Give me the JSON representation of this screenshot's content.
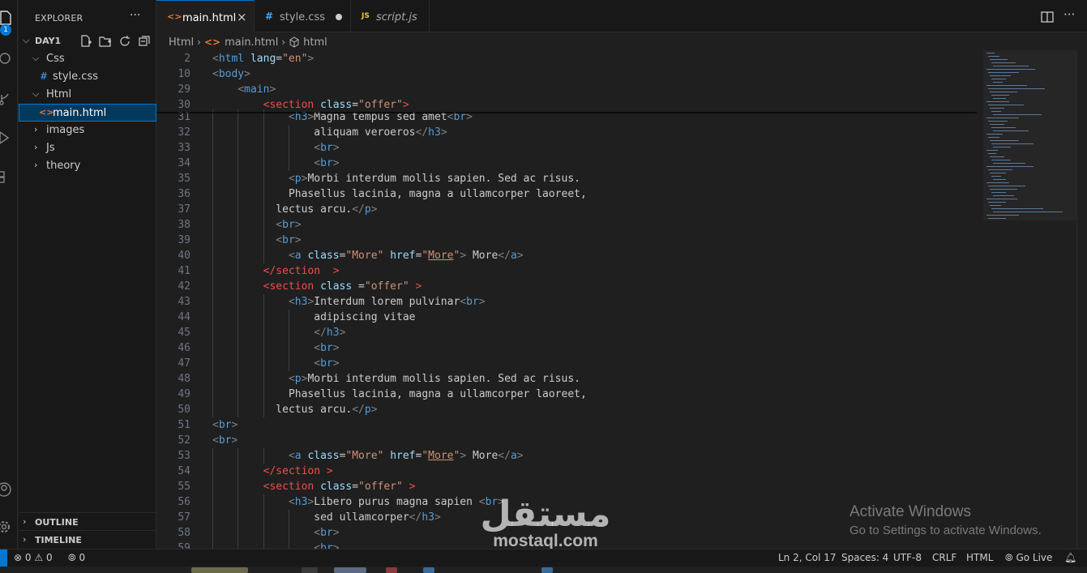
{
  "explorer": {
    "title": "EXPLORER",
    "more": "···",
    "folder": "DAY1",
    "items": [
      {
        "label": "Css",
        "type": "folder-open"
      },
      {
        "label": "style.css",
        "type": "css-file"
      },
      {
        "label": "Html",
        "type": "folder-open"
      },
      {
        "label": "main.html",
        "type": "html-file",
        "selected": true
      },
      {
        "label": "images",
        "type": "folder-closed"
      },
      {
        "label": "Js",
        "type": "folder-closed"
      },
      {
        "label": "theory",
        "type": "folder-closed"
      }
    ],
    "outline": "OUTLINE",
    "timeline": "TIMELINE"
  },
  "activity": {
    "badge": "1"
  },
  "tabs": [
    {
      "label": "main.html",
      "icon": "<>",
      "active": true,
      "close": "×"
    },
    {
      "label": "style.css",
      "icon": "#",
      "modified": true
    },
    {
      "label": "script.js",
      "icon": "JS"
    }
  ],
  "breadcrumb": [
    "Html",
    "main.html",
    "html"
  ],
  "lines": [
    {
      "n": "2",
      "indent": 0,
      "segs": [
        [
          "p",
          "<"
        ],
        [
          "t",
          "html"
        ],
        [
          "x",
          " "
        ],
        [
          "a",
          "lang"
        ],
        [
          "x",
          "="
        ],
        [
          "s",
          "\"en\""
        ],
        [
          "p",
          ">"
        ]
      ]
    },
    {
      "n": "10",
      "indent": 0,
      "segs": [
        [
          "p",
          "<"
        ],
        [
          "t",
          "body"
        ],
        [
          "p",
          ">"
        ]
      ]
    },
    {
      "n": "29",
      "indent": 4,
      "segs": [
        [
          "p",
          "<"
        ],
        [
          "t",
          "main"
        ],
        [
          "p",
          ">"
        ]
      ]
    },
    {
      "n": "30",
      "indent": 8,
      "segs": [
        [
          "p",
          "<"
        ],
        [
          "t",
          "section"
        ],
        [
          "x",
          " "
        ],
        [
          "a",
          "class"
        ],
        [
          "x",
          "="
        ],
        [
          "s",
          "\"offer\""
        ],
        [
          "p",
          ">"
        ]
      ]
    },
    {
      "n": "31",
      "indent": 12,
      "segs": [
        [
          "p",
          "<"
        ],
        [
          "t",
          "h3"
        ],
        [
          "p",
          ">"
        ],
        [
          "x",
          "Magna tempus sed amet"
        ],
        [
          "p",
          "<"
        ],
        [
          "t",
          "br"
        ],
        [
          "p",
          ">"
        ]
      ]
    },
    {
      "n": "32",
      "indent": 16,
      "segs": [
        [
          "x",
          "aliquam veroeros"
        ],
        [
          "p",
          "</"
        ],
        [
          "t",
          "h3"
        ],
        [
          "p",
          ">"
        ]
      ]
    },
    {
      "n": "33",
      "indent": 16,
      "segs": [
        [
          "p",
          "<"
        ],
        [
          "t",
          "br"
        ],
        [
          "p",
          ">"
        ]
      ]
    },
    {
      "n": "34",
      "indent": 16,
      "segs": [
        [
          "p",
          "<"
        ],
        [
          "t",
          "br"
        ],
        [
          "p",
          ">"
        ]
      ]
    },
    {
      "n": "35",
      "indent": 12,
      "segs": [
        [
          "p",
          "<"
        ],
        [
          "t",
          "p"
        ],
        [
          "p",
          ">"
        ],
        [
          "x",
          "Morbi interdum mollis sapien. Sed ac risus."
        ]
      ]
    },
    {
      "n": "36",
      "indent": 12,
      "segs": [
        [
          "x",
          "Phasellus lacinia, magna a ullamcorper laoreet,"
        ]
      ]
    },
    {
      "n": "37",
      "indent": 10,
      "segs": [
        [
          "x",
          "lectus arcu."
        ],
        [
          "p",
          "</"
        ],
        [
          "t",
          "p"
        ],
        [
          "p",
          ">"
        ]
      ]
    },
    {
      "n": "38",
      "indent": 10,
      "segs": [
        [
          "p",
          "<"
        ],
        [
          "t",
          "br"
        ],
        [
          "p",
          ">"
        ]
      ]
    },
    {
      "n": "39",
      "indent": 10,
      "segs": [
        [
          "p",
          "<"
        ],
        [
          "t",
          "br"
        ],
        [
          "p",
          ">"
        ]
      ]
    },
    {
      "n": "40",
      "indent": 12,
      "segs": [
        [
          "p",
          "<"
        ],
        [
          "t",
          "a"
        ],
        [
          "x",
          " "
        ],
        [
          "a",
          "class"
        ],
        [
          "x",
          "="
        ],
        [
          "s",
          "\"More\""
        ],
        [
          "x",
          " "
        ],
        [
          "a",
          "href"
        ],
        [
          "x",
          "="
        ],
        [
          "s",
          "\""
        ],
        [
          "su",
          "More"
        ],
        [
          "s",
          "\""
        ],
        [
          "p",
          ">"
        ],
        [
          "x",
          " More"
        ],
        [
          "p",
          "</"
        ],
        [
          "t",
          "a"
        ],
        [
          "p",
          ">"
        ]
      ]
    },
    {
      "n": "41",
      "indent": 8,
      "segs": [
        [
          "p",
          "</"
        ],
        [
          "t",
          "section"
        ],
        [
          "x",
          "  "
        ],
        [
          "p",
          ">"
        ]
      ]
    },
    {
      "n": "42",
      "indent": 8,
      "segs": [
        [
          "p",
          "<"
        ],
        [
          "t",
          "section"
        ],
        [
          "x",
          " "
        ],
        [
          "a",
          "class"
        ],
        [
          "x",
          " ="
        ],
        [
          "s",
          "\"offer\""
        ],
        [
          "x",
          " "
        ],
        [
          "p",
          ">"
        ]
      ]
    },
    {
      "n": "43",
      "indent": 12,
      "segs": [
        [
          "p",
          "<"
        ],
        [
          "t",
          "h3"
        ],
        [
          "p",
          ">"
        ],
        [
          "x",
          "Interdum lorem pulvinar"
        ],
        [
          "p",
          "<"
        ],
        [
          "t",
          "br"
        ],
        [
          "p",
          ">"
        ]
      ]
    },
    {
      "n": "44",
      "indent": 16,
      "segs": [
        [
          "x",
          "adipiscing vitae"
        ]
      ]
    },
    {
      "n": "45",
      "indent": 16,
      "segs": [
        [
          "p",
          "</"
        ],
        [
          "t",
          "h3"
        ],
        [
          "p",
          ">"
        ]
      ]
    },
    {
      "n": "46",
      "indent": 16,
      "segs": [
        [
          "p",
          "<"
        ],
        [
          "t",
          "br"
        ],
        [
          "p",
          ">"
        ]
      ]
    },
    {
      "n": "47",
      "indent": 16,
      "segs": [
        [
          "p",
          "<"
        ],
        [
          "t",
          "br"
        ],
        [
          "p",
          ">"
        ]
      ]
    },
    {
      "n": "48",
      "indent": 12,
      "segs": [
        [
          "p",
          "<"
        ],
        [
          "t",
          "p"
        ],
        [
          "p",
          ">"
        ],
        [
          "x",
          "Morbi interdum mollis sapien. Sed ac risus."
        ]
      ]
    },
    {
      "n": "49",
      "indent": 12,
      "segs": [
        [
          "x",
          "Phasellus lacinia, magna a ullamcorper laoreet,"
        ]
      ]
    },
    {
      "n": "50",
      "indent": 10,
      "segs": [
        [
          "x",
          "lectus arcu."
        ],
        [
          "p",
          "</"
        ],
        [
          "t",
          "p"
        ],
        [
          "p",
          ">"
        ]
      ]
    },
    {
      "n": "51",
      "indent": 0,
      "segs": [
        [
          "p",
          "<"
        ],
        [
          "t",
          "br"
        ],
        [
          "p",
          ">"
        ]
      ]
    },
    {
      "n": "52",
      "indent": 0,
      "segs": [
        [
          "p",
          "<"
        ],
        [
          "t",
          "br"
        ],
        [
          "p",
          ">"
        ]
      ]
    },
    {
      "n": "53",
      "indent": 12,
      "segs": [
        [
          "p",
          "<"
        ],
        [
          "t",
          "a"
        ],
        [
          "x",
          " "
        ],
        [
          "a",
          "class"
        ],
        [
          "x",
          "="
        ],
        [
          "s",
          "\"More\""
        ],
        [
          "x",
          " "
        ],
        [
          "a",
          "href"
        ],
        [
          "x",
          "="
        ],
        [
          "s",
          "\""
        ],
        [
          "su",
          "More"
        ],
        [
          "s",
          "\""
        ],
        [
          "p",
          ">"
        ],
        [
          "x",
          " More"
        ],
        [
          "p",
          "</"
        ],
        [
          "t",
          "a"
        ],
        [
          "p",
          ">"
        ]
      ]
    },
    {
      "n": "54",
      "indent": 8,
      "segs": [
        [
          "p",
          "</"
        ],
        [
          "t",
          "section"
        ],
        [
          "x",
          " "
        ],
        [
          "p",
          ">"
        ]
      ]
    },
    {
      "n": "55",
      "indent": 8,
      "segs": [
        [
          "p",
          "<"
        ],
        [
          "t",
          "section"
        ],
        [
          "x",
          " "
        ],
        [
          "a",
          "class"
        ],
        [
          "x",
          "="
        ],
        [
          "s",
          "\"offer\""
        ],
        [
          "x",
          " "
        ],
        [
          "p",
          ">"
        ]
      ]
    },
    {
      "n": "56",
      "indent": 12,
      "segs": [
        [
          "p",
          "<"
        ],
        [
          "t",
          "h3"
        ],
        [
          "p",
          ">"
        ],
        [
          "x",
          "Libero purus magna sapien "
        ],
        [
          "p",
          "<"
        ],
        [
          "t",
          "br"
        ],
        [
          "p",
          ">"
        ]
      ]
    },
    {
      "n": "57",
      "indent": 16,
      "segs": [
        [
          "x",
          "sed ullamcorper"
        ],
        [
          "p",
          "</"
        ],
        [
          "t",
          "h3"
        ],
        [
          "p",
          ">"
        ]
      ]
    },
    {
      "n": "58",
      "indent": 16,
      "segs": [
        [
          "p",
          "<"
        ],
        [
          "t",
          "br"
        ],
        [
          "p",
          ">"
        ]
      ]
    },
    {
      "n": "59",
      "indent": 16,
      "segs": [
        [
          "p",
          "<"
        ],
        [
          "t",
          "br"
        ],
        [
          "p",
          ">"
        ]
      ]
    }
  ],
  "watermark": {
    "activate_title": "Activate Windows",
    "activate_sub": "Go to Settings to activate Windows.",
    "mostaql_ar": "مستقل",
    "mostaql_en": "mostaql.com"
  },
  "status": {
    "errors": "0",
    "warnings": "0",
    "ports": "0",
    "position": "Ln 2, Col 17",
    "spaces": "Spaces: 4",
    "encoding": "UTF-8",
    "eol": "CRLF",
    "language": "HTML",
    "golive": "Go Live"
  },
  "colors": {
    "accent": "#0078d4",
    "tag": "#569cd6",
    "attr": "#9cdcfe",
    "string": "#ce9178",
    "punct": "#808080",
    "section_tag": "#f14c4c"
  }
}
